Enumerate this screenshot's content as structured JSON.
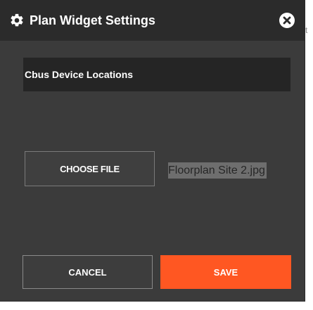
{
  "header": {
    "title": "Plan Widget Settings",
    "icon": "gear-icon",
    "close_icon": "close-icon"
  },
  "background_edge_text": "t",
  "form": {
    "name_value": "Cbus Device Locations",
    "choose_file_label": "CHOOSE FILE",
    "selected_file": "Floorplan Site 2.jpg"
  },
  "footer": {
    "cancel_label": "CANCEL",
    "save_label": "SAVE"
  },
  "colors": {
    "dialog_bg": "#3b3b3b",
    "header_bg": "#2b2b2b",
    "accent": "#ff5722"
  }
}
